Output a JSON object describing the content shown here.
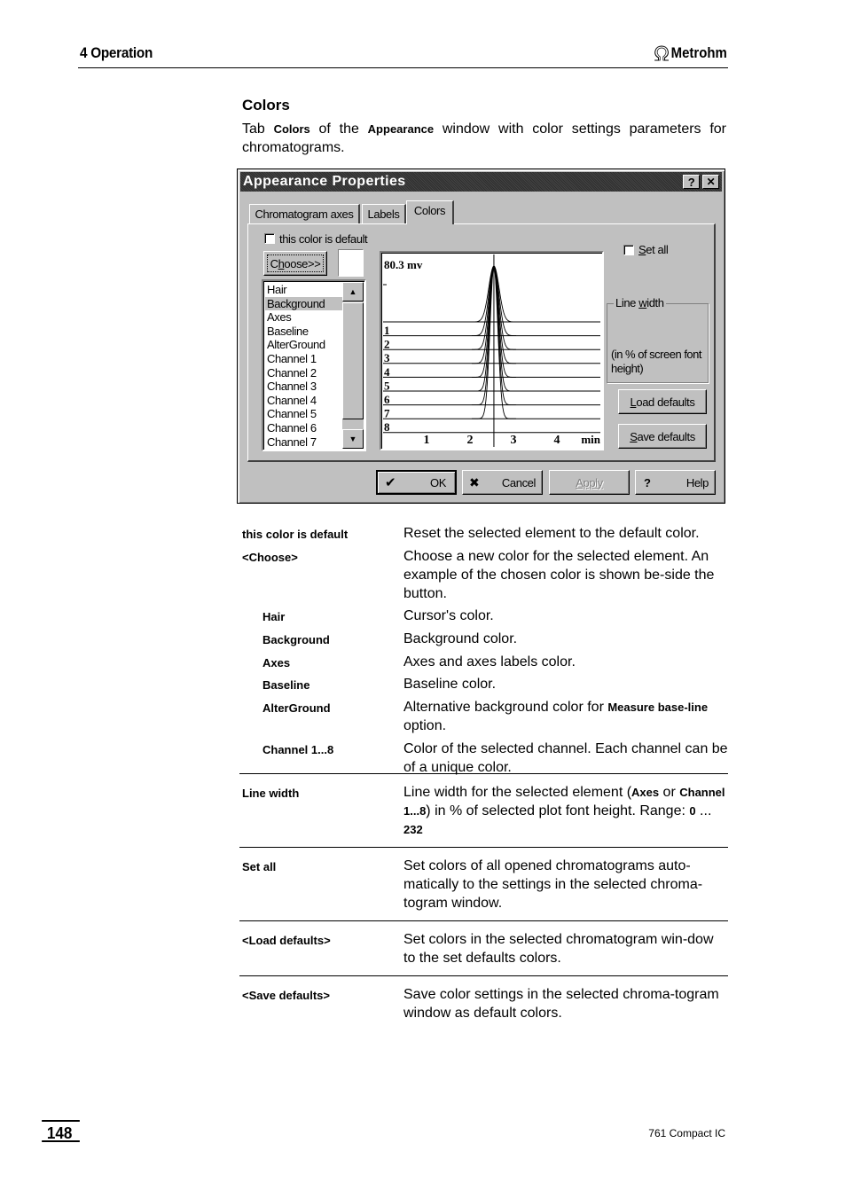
{
  "page_header": {
    "chapter": "4 Operation",
    "brand": "Metrohm",
    "brand_icon": "omega-logo-icon"
  },
  "section": {
    "title": "Colors",
    "intro_parts": [
      "Tab ",
      "Colors",
      " of the ",
      "Appearance",
      " window with color settings parameters for chromatograms."
    ]
  },
  "dialog": {
    "title": "Appearance Properties",
    "titlebar_buttons": [
      {
        "icon": "help-icon",
        "glyph": "?"
      },
      {
        "icon": "close-icon",
        "glyph": "✕"
      }
    ],
    "tabs": [
      {
        "label": "Chromatogram axes",
        "active": false
      },
      {
        "label": "Labels",
        "active": false
      },
      {
        "label": "Colors",
        "active": true
      }
    ],
    "this_color_is_default": {
      "label": "this color is default",
      "checked": false
    },
    "choose_button": {
      "label_pre": "C",
      "label_u": "h",
      "label_post": "oose>>"
    },
    "set_all": {
      "label_u": "S",
      "label_post": "et all",
      "checked": false
    },
    "element_list": {
      "items": [
        "Hair",
        "Background",
        "Axes",
        "Baseline",
        "AlterGround",
        "Channel 1",
        "Channel 2",
        "Channel 3",
        "Channel 4",
        "Channel 5",
        "Channel 6",
        "Channel 7"
      ],
      "selected": "Background"
    },
    "line_width_group": {
      "title_pre": "Line ",
      "title_u": "w",
      "title_post": "idth",
      "note": "(in % of screen font height)"
    },
    "load_defaults": {
      "label_u": "L",
      "label_post": "oad defaults"
    },
    "save_defaults": {
      "label_u": "S",
      "label_post": "ave defaults"
    },
    "footer_buttons": [
      {
        "label": "OK",
        "icon": "checkmark-icon",
        "glyph": "✔",
        "enabled": true,
        "default": true
      },
      {
        "label": "Cancel",
        "icon": "cross-icon",
        "glyph": "✖",
        "enabled": true,
        "default": false
      },
      {
        "label": "Apply",
        "icon": "",
        "glyph": "",
        "enabled": false,
        "default": false
      },
      {
        "label": "Help",
        "icon": "question-icon",
        "glyph": "?",
        "enabled": true,
        "default": false
      }
    ],
    "preview": {
      "y_label": "80.3 mv",
      "x_ticks": [
        "1",
        "2",
        "3",
        "4"
      ],
      "x_unit": "min",
      "channel_labels": [
        "1",
        "2",
        "3",
        "4",
        "5",
        "6",
        "7",
        "8"
      ],
      "cursor_time": 2.55,
      "x_range": [
        0,
        5
      ],
      "peak_center": 2.55
    }
  },
  "descriptions": [
    {
      "term": "this color is default",
      "indent": false,
      "parts": [
        {
          "t": "Reset the selected element to the default color."
        }
      ]
    },
    {
      "term": "<Choose>",
      "indent": false,
      "parts": [
        {
          "t": "Choose a new color for the selected element. An example of the chosen color is shown be-side the button."
        }
      ]
    },
    {
      "term": "Hair",
      "indent": true,
      "parts": [
        {
          "t": "Cursor's color."
        }
      ]
    },
    {
      "term": "Background",
      "indent": true,
      "parts": [
        {
          "t": "Background color."
        }
      ]
    },
    {
      "term": "Axes",
      "indent": true,
      "parts": [
        {
          "t": "Axes and axes labels color."
        }
      ]
    },
    {
      "term": "Baseline",
      "indent": true,
      "parts": [
        {
          "t": "Baseline color."
        }
      ]
    },
    {
      "term": "AlterGround",
      "indent": true,
      "parts": [
        {
          "t": "Alternative background color for "
        },
        {
          "b": "Measure base-line"
        },
        {
          "t": " option."
        }
      ]
    },
    {
      "term": "Channel 1...8",
      "indent": true,
      "parts": [
        {
          "t": "Color of the selected channel. Each channel can be of a unique color."
        }
      ]
    },
    {
      "term": "Line width",
      "indent": false,
      "parts": [
        {
          "t": "Line width for the selected element ("
        },
        {
          "b": "Axes"
        },
        {
          "t": " or "
        },
        {
          "b": "Channel 1...8"
        },
        {
          "t": ") in % of selected plot font height. Range: "
        },
        {
          "b": "0"
        },
        {
          "t": " ... "
        },
        {
          "b": "232"
        }
      ]
    },
    {
      "term": "Set all",
      "indent": false,
      "parts": [
        {
          "t": "Set colors of all opened chromatograms auto-matically to the settings in the selected chroma-togram window."
        }
      ]
    },
    {
      "term": "<Load defaults>",
      "indent": false,
      "parts": [
        {
          "t": "Set colors in the selected chromatogram win-dow to the set defaults colors."
        }
      ]
    },
    {
      "term": "<Save defaults>",
      "indent": false,
      "parts": [
        {
          "t": "Save color settings in the selected chroma-togram window as default colors."
        }
      ]
    }
  ],
  "page_footer": {
    "page_number": "148",
    "product": "761 Compact IC"
  }
}
